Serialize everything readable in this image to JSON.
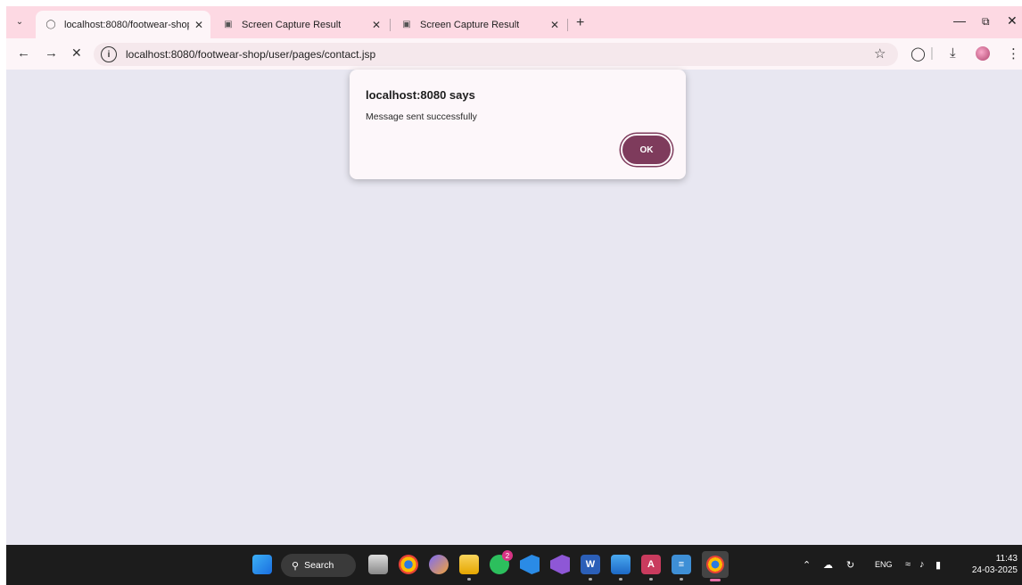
{
  "tabs": [
    {
      "title": "localhost:8080/footwear-shop/​",
      "active": true
    },
    {
      "title": "Screen Capture Result",
      "active": false
    },
    {
      "title": "Screen Capture Result",
      "active": false
    }
  ],
  "address": {
    "url": "localhost:8080/footwear-shop/user/pages/contact.jsp"
  },
  "dialog": {
    "title": "localhost:8080 says",
    "message": "Message sent successfully",
    "ok_label": "OK"
  },
  "taskbar": {
    "search_label": "Search",
    "whatsapp_badge": "2",
    "lang": "ENG",
    "time": "11:43",
    "date": "24-03-2025"
  },
  "colors": {
    "tabstrip": "#fdd9e3",
    "page_bg": "#e8e7f1",
    "accent": "#7e3b5c"
  }
}
